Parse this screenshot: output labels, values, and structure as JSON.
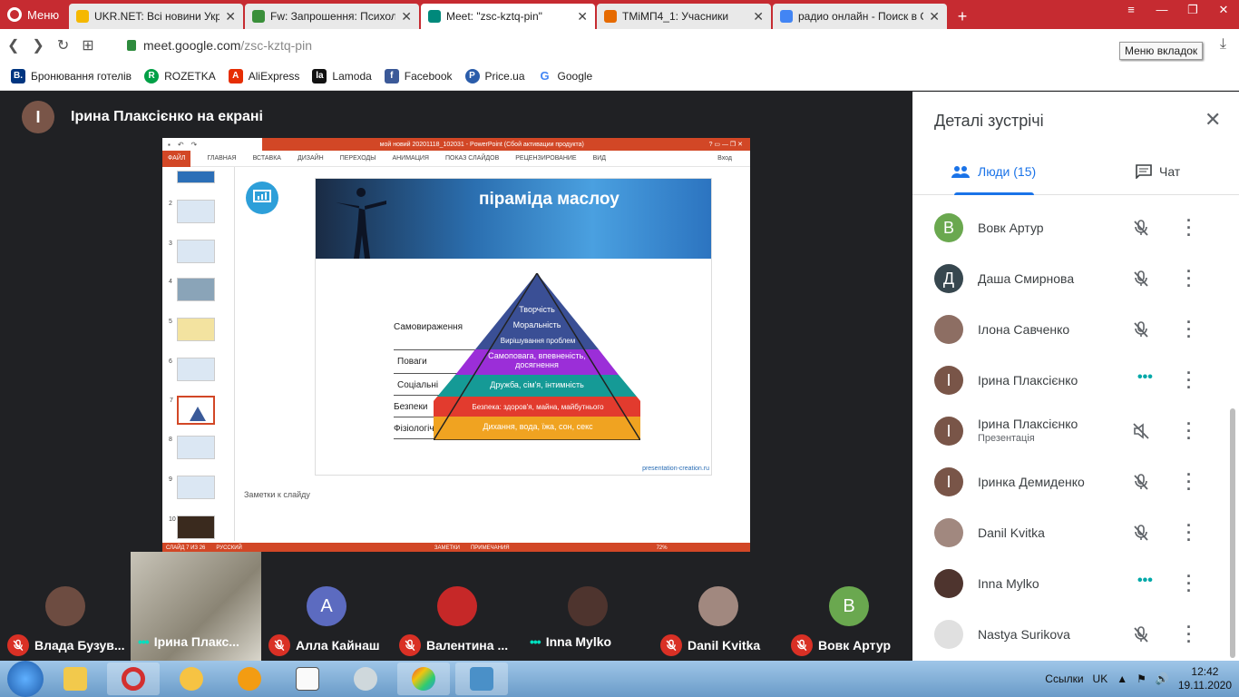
{
  "browser": {
    "menu_label": "Меню",
    "tabs": [
      {
        "title": "UKR.NET: Всі новини Укра",
        "fav_color": "#f5b800"
      },
      {
        "title": "Fw: Запрошення: Психол",
        "fav_color": "#3a8f3a"
      },
      {
        "title": "Meet: \"zsc-kztq-pin\"",
        "fav_color": "#00897b",
        "active": true
      },
      {
        "title": "ТМіМП4_1: Учасники",
        "fav_color": "#e66a00"
      },
      {
        "title": "радио онлайн - Поиск в G",
        "fav_color": "#4285f4"
      }
    ],
    "address_host": "meet.google.com",
    "address_path": "/zsc-kztq-pin",
    "tooltip": "Меню вкладок",
    "bookmarks": [
      {
        "label": "Бронювання готелів",
        "icon": "B.",
        "color": "#003580"
      },
      {
        "label": "ROZETKA",
        "icon": "R",
        "color": "#00a046"
      },
      {
        "label": "AliExpress",
        "icon": "A",
        "color": "#e62e04"
      },
      {
        "label": "Lamoda",
        "icon": "la",
        "color": "#111111"
      },
      {
        "label": "Facebook",
        "icon": "f",
        "color": "#3b5998"
      },
      {
        "label": "Price.ua",
        "icon": "P",
        "color": "#2a5caa"
      },
      {
        "label": "Google",
        "icon": "G",
        "color": "#4285f4"
      }
    ]
  },
  "meeting": {
    "presenter_initial": "І",
    "presenter_label": "Ірина Плаксієнко на екрані",
    "side_title": "Деталі зустрічі",
    "tab_people": "Люди (15)",
    "tab_chat": "Чат",
    "people": [
      {
        "name": "Вовк Артур",
        "initial": "В",
        "color": "#6aa84f",
        "status": "muted"
      },
      {
        "name": "Даша Смирнова",
        "initial": "Д",
        "color": "#37474f",
        "status": "muted"
      },
      {
        "name": "Ілона Савченко",
        "initial": "",
        "color": "#8d6e63",
        "status": "muted"
      },
      {
        "name": "Ірина Плаксієнко",
        "initial": "І",
        "color": "#795548",
        "status": "speaking"
      },
      {
        "name": "Ірина Плаксієнко",
        "sub": "Презентація",
        "initial": "І",
        "color": "#795548",
        "status": "sound-off"
      },
      {
        "name": "Іринка Демиденко",
        "initial": "І",
        "color": "#795548",
        "status": "muted"
      },
      {
        "name": "Danil Kvitka",
        "initial": "",
        "color": "#a1887f",
        "status": "muted"
      },
      {
        "name": "Inna Mylko",
        "initial": "",
        "color": "#4e342e",
        "status": "speaking"
      },
      {
        "name": "Nastya Surikova",
        "initial": "",
        "color": "#e0e0e0",
        "status": "muted"
      }
    ],
    "strip": [
      {
        "label": "Влада Бузув...",
        "initial": "",
        "color": "#6d4c41",
        "status": "muted"
      },
      {
        "label": "Ірина Плакс...",
        "initial": "",
        "color": "",
        "status": "speaking",
        "camera": true
      },
      {
        "label": "Алла Кайнаш",
        "initial": "А",
        "color": "#5c6bc0",
        "status": "muted"
      },
      {
        "label": "Валентина ...",
        "initial": "",
        "color": "#c62828",
        "status": "muted"
      },
      {
        "label": "Inna Mylko",
        "initial": "",
        "color": "#4e342e",
        "status": "speaking"
      },
      {
        "label": "Danil Kvitka",
        "initial": "",
        "color": "#a1887f",
        "status": "muted"
      },
      {
        "label": "Вовк Артур",
        "initial": "В",
        "color": "#6aa84f",
        "status": "muted"
      }
    ]
  },
  "ppt": {
    "window_title": "мой новий 20201118_102031 - PowerPoint (Сбой активации продукта)",
    "ribbon": [
      "ФАЙЛ",
      "ГЛАВНАЯ",
      "ВСТАВКА",
      "ДИЗАЙН",
      "ПЕРЕХОДЫ",
      "АНИМАЦИЯ",
      "ПОКАЗ СЛАЙДОВ",
      "РЕЦЕНЗИРОВАНИЕ",
      "ВИД"
    ],
    "signin": "Вход",
    "slide_title": "піраміда маслоу",
    "labels": [
      "Самовираження",
      "Поваги",
      "Соціальні",
      "Безпеки",
      "Фізіологічні"
    ],
    "layers": [
      "Творчість",
      "Моральність",
      "Вирішування проблем",
      "Самоповага, впевненість, досягнення",
      "Дружба, сім'я, інтимність",
      "Безпека: здоров'я, майна, майбутнього",
      "Дихання, вода, їжа, сон, секс"
    ],
    "credit": "presentation-creation.ru",
    "notes": "Заметки к слайду",
    "status_left": "СЛАЙД 7 ИЗ 26",
    "status_lang": "РУССКИЙ",
    "status_notes": "ЗАМЕТКИ",
    "status_comments": "ПРИМЕЧАНИЯ",
    "zoom": "72%",
    "thumb_numbers": [
      "2",
      "3",
      "4",
      "5",
      "6",
      "7",
      "8",
      "9",
      "10"
    ]
  },
  "taskbar": {
    "tray_text": "Ссылки",
    "lang": "UK",
    "time": "12:42",
    "date": "19.11.2020"
  }
}
